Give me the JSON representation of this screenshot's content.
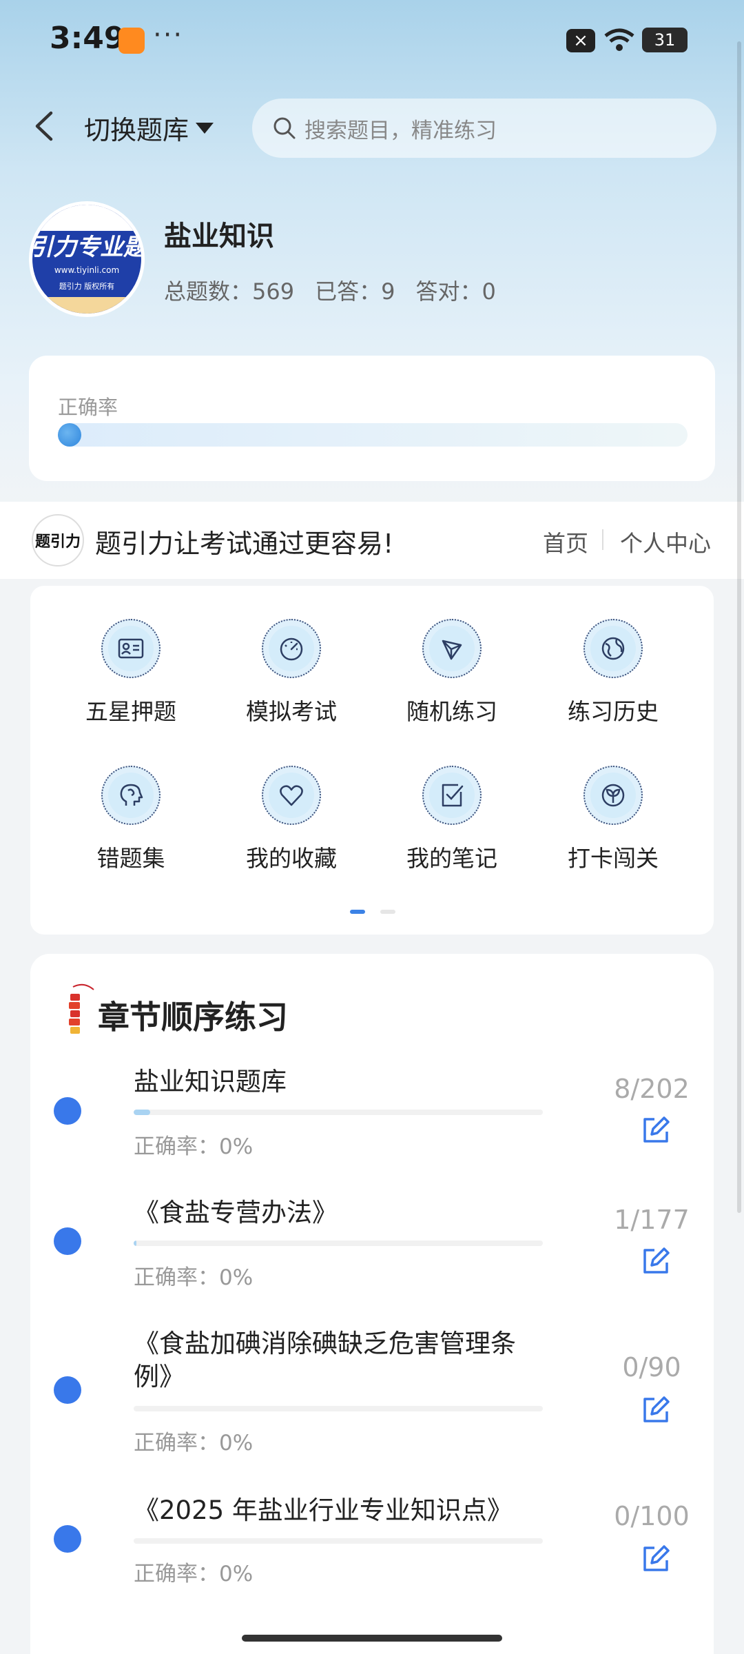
{
  "status_bar": {
    "time": "3:49",
    "dots": "···",
    "close_icon": "×",
    "battery": "31"
  },
  "header": {
    "switch_label": "切换题库",
    "search_placeholder": "搜索题目，精准练习"
  },
  "profile": {
    "logo_band": "引力专业题",
    "logo_url": "www.tiyinli.com",
    "logo_sub": "题引力 版权所有",
    "name": "盐业知识",
    "total_label": "总题数：",
    "total": "569",
    "answered_label": "已答：",
    "answered": "9",
    "correct_label": "答对：",
    "correct": "0"
  },
  "accuracy": {
    "label": "正确率",
    "value": 0
  },
  "promo": {
    "logo_text": "题引力",
    "slogan": "题引力让考试通过更容易!",
    "home": "首页",
    "center": "个人中心"
  },
  "functions": [
    {
      "label": "五星押题",
      "icon": "id-card-icon"
    },
    {
      "label": "模拟考试",
      "icon": "gauge-icon"
    },
    {
      "label": "随机练习",
      "icon": "network-icon"
    },
    {
      "label": "练习历史",
      "icon": "globe-icon"
    },
    {
      "label": "错题集",
      "icon": "brain-head-icon"
    },
    {
      "label": "我的收藏",
      "icon": "heart-icon"
    },
    {
      "label": "我的笔记",
      "icon": "note-check-icon"
    },
    {
      "label": "打卡闯关",
      "icon": "sprout-icon"
    }
  ],
  "chapters": {
    "title": "章节顺序练习",
    "items": [
      {
        "name": "盐业知识题库",
        "progress": 0.04,
        "count": "8/202",
        "accuracy": "正确率：0%"
      },
      {
        "name": "《食盐专营办法》",
        "progress": 0.006,
        "count": "1/177",
        "accuracy": "正确率：0%"
      },
      {
        "name": "《食盐加碘消除碘缺乏危害管理条例》",
        "progress": 0,
        "count": "0/90",
        "accuracy": "正确率：0%"
      },
      {
        "name": "《2025 年盐业行业专业知识点》",
        "progress": 0,
        "count": "0/100",
        "accuracy": "正确率：0%"
      }
    ]
  },
  "colors": {
    "accent": "#3978ea",
    "progress_fill": "#a9d3f2"
  }
}
